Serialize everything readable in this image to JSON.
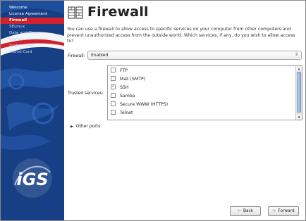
{
  "sidebar": {
    "steps": [
      {
        "label": "Welcome",
        "state": "done"
      },
      {
        "label": "License Agreement",
        "state": "done"
      },
      {
        "label": "Firewall",
        "state": "current"
      },
      {
        "label": "SELinux",
        "state": "pending"
      },
      {
        "label": "Date and Time",
        "state": "pending"
      },
      {
        "label": "Display",
        "state": "pending"
      },
      {
        "label": "System User",
        "state": "pending"
      },
      {
        "label": "Sound Card",
        "state": "pending"
      }
    ],
    "logo_text": "iGS",
    "colors": {
      "background": "#163f86",
      "current": "#d0212c"
    }
  },
  "header": {
    "title": "Firewall",
    "icon": "firewall-icon"
  },
  "description": "You can use a firewall to allow access to specific services on your computer from other computers and prevent unauthorized access from the outside world. Which services, if any, do you wish to allow access to?",
  "firewall": {
    "label": "Firewall:",
    "value": "Enabled"
  },
  "trusted_services": {
    "label": "Trusted services:",
    "items": [
      {
        "label": "FTP",
        "checked": false
      },
      {
        "label": "Mail (SMTP)",
        "checked": false
      },
      {
        "label": "SSH",
        "checked": true
      },
      {
        "label": "Samba",
        "checked": false
      },
      {
        "label": "Secure WWW (HTTPS)",
        "checked": false
      },
      {
        "label": "Telnet",
        "checked": false
      }
    ]
  },
  "other_ports": {
    "label": "Other ports"
  },
  "buttons": {
    "back": "Back",
    "forward": "Forward"
  }
}
